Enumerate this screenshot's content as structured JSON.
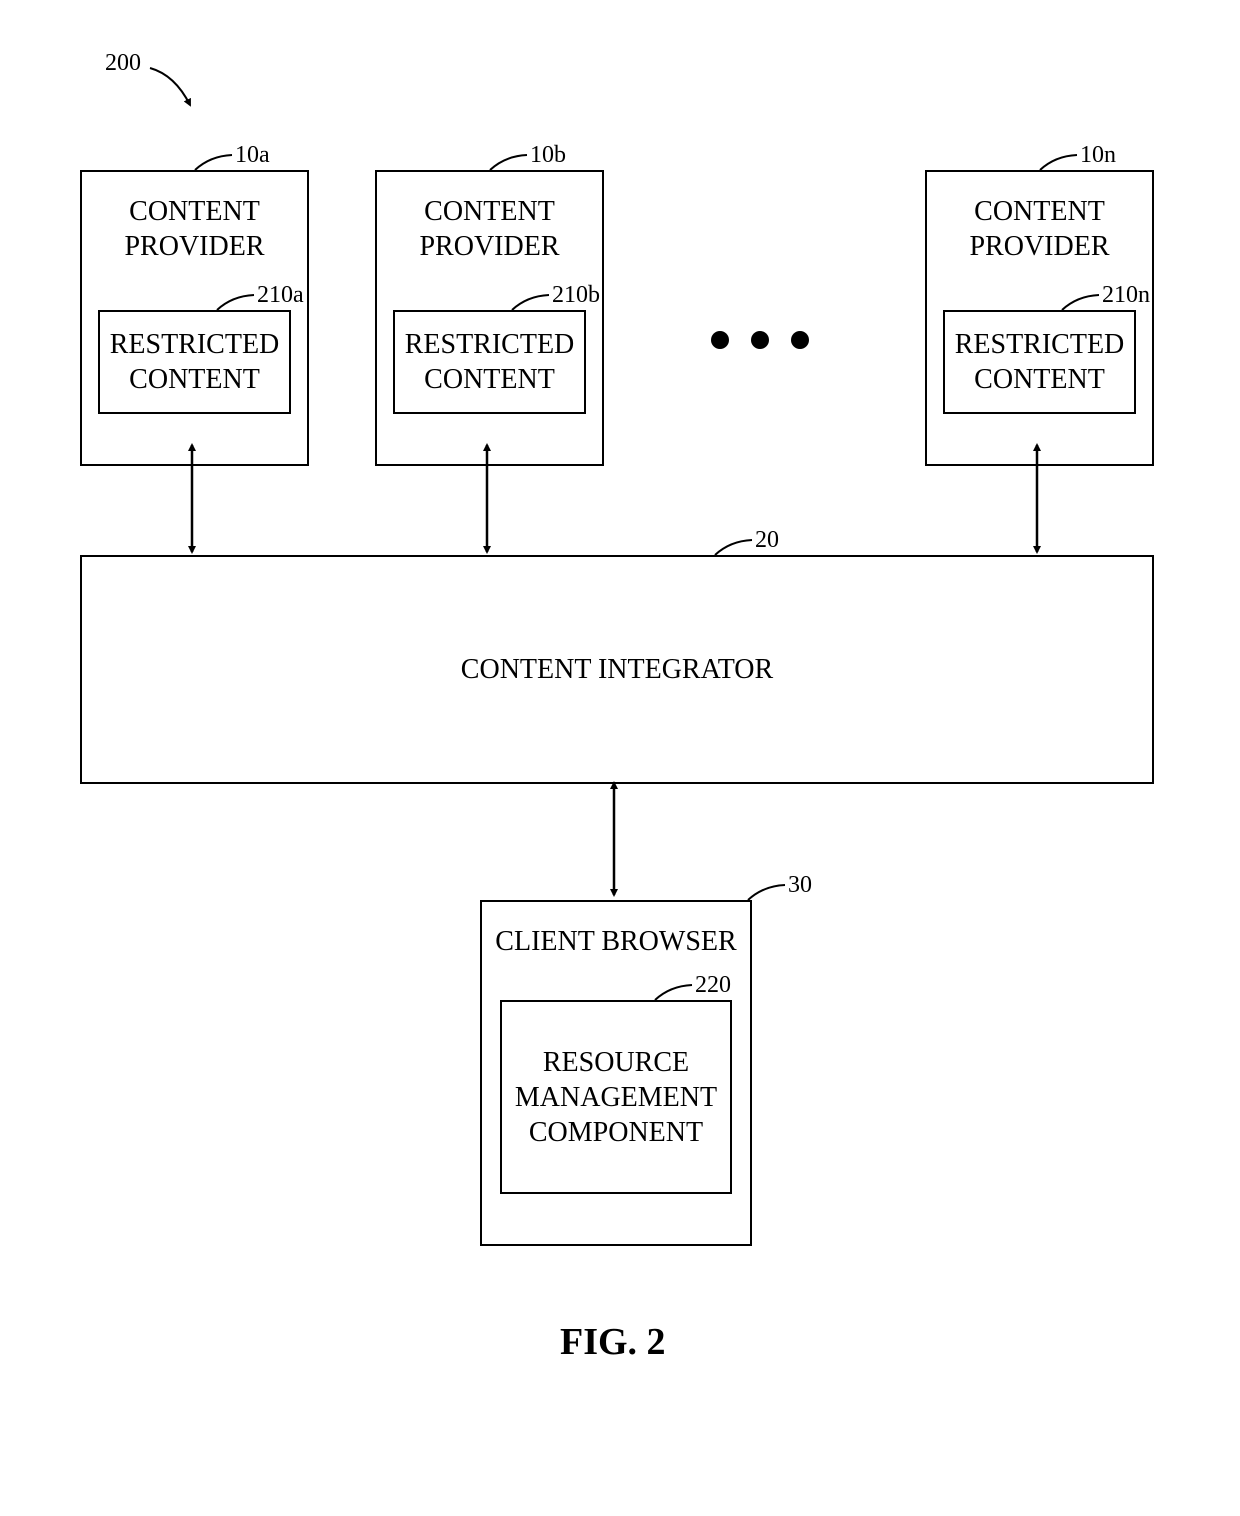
{
  "ref200": "200",
  "ref10a": "10a",
  "ref10b": "10b",
  "ref10n": "10n",
  "ref210a": "210a",
  "ref210b": "210b",
  "ref210n": "210n",
  "ref20": "20",
  "ref30": "30",
  "ref220": "220",
  "figLabel": "FIG. 2",
  "contentProvider": "CONTENT\nPROVIDER",
  "restrictedContent": "RESTRICTED\nCONTENT",
  "contentIntegrator": "CONTENT INTEGRATOR",
  "clientBrowser": "CLIENT BROWSER",
  "resourceMgmt": "RESOURCE\nMANAGEMENT\nCOMPONENT"
}
